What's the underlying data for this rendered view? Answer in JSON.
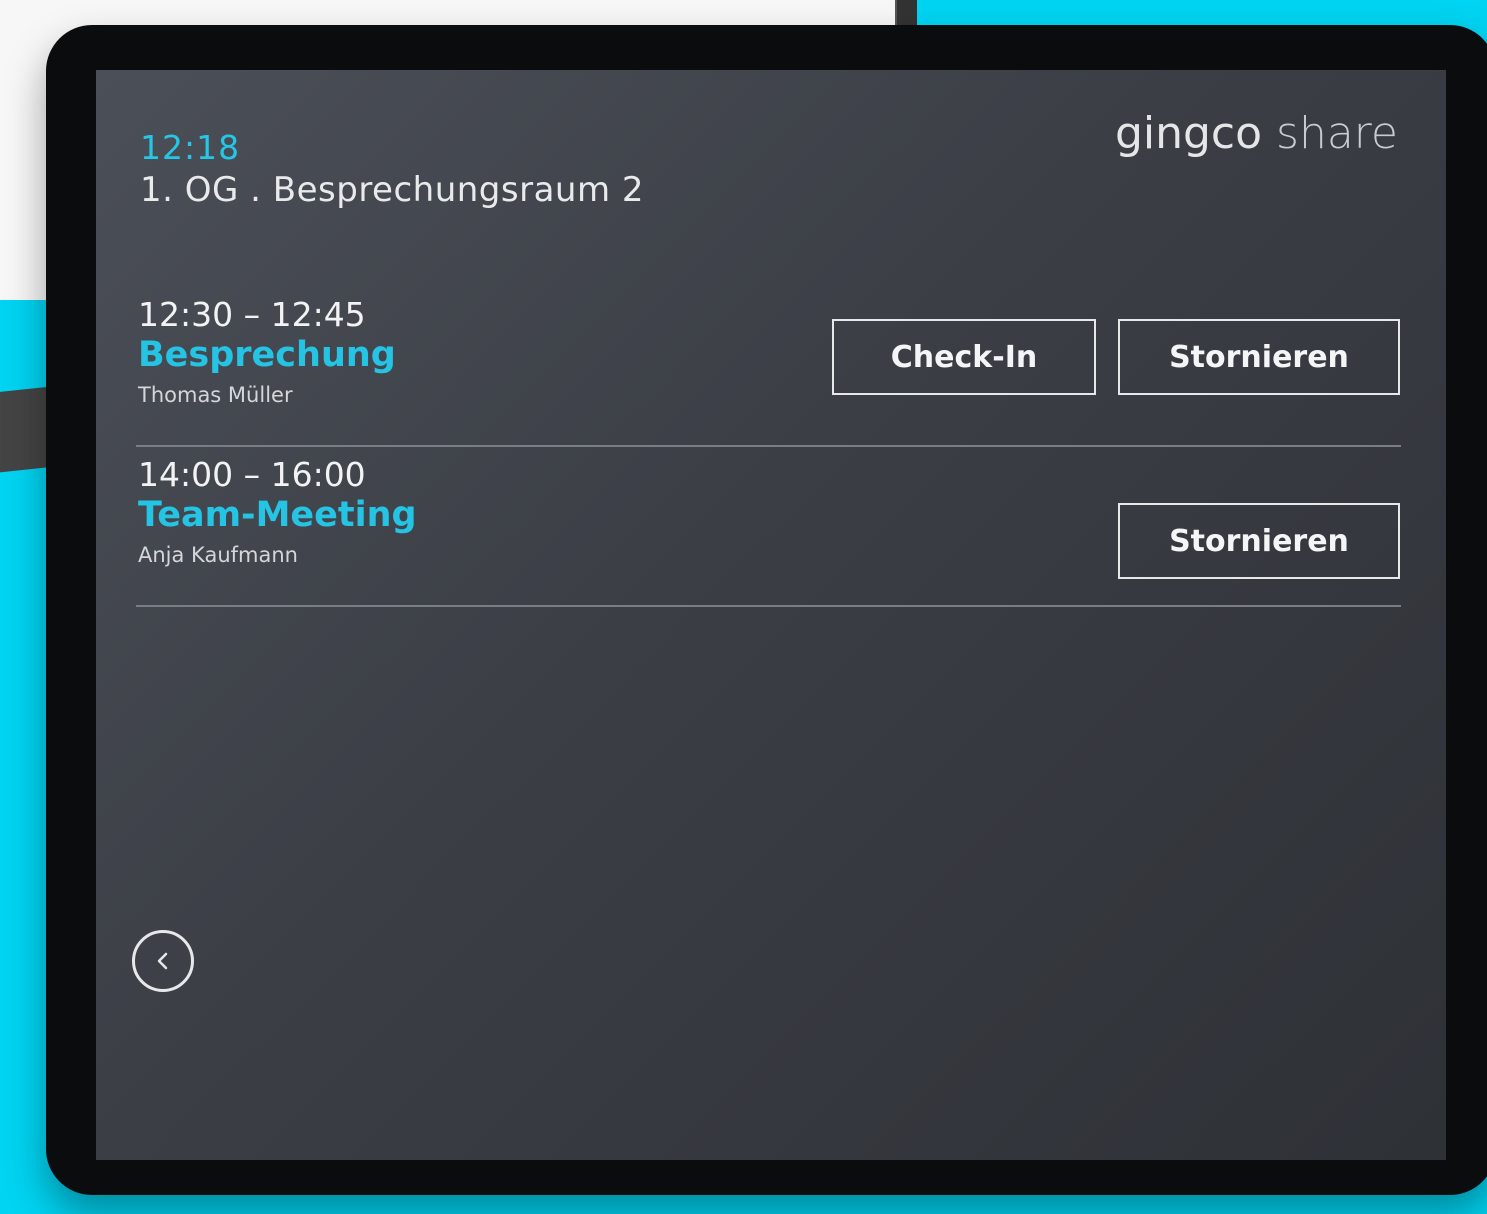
{
  "header": {
    "time": "12:18",
    "room": "1. OG . Besprechungsraum 2",
    "brand_bold": "gingco",
    "brand_light": "share"
  },
  "bookings": [
    {
      "time": "12:30 – 12:45",
      "title": "Besprechung",
      "organizer": "Thomas Müller",
      "checkin_label": "Check-In",
      "cancel_label": "Stornieren"
    },
    {
      "time": "14:00 – 16:00",
      "title": "Team-Meeting",
      "organizer": "Anja Kaufmann",
      "cancel_label": "Stornieren"
    }
  ],
  "navigation": {
    "back_icon": "chevron-left-circle-icon"
  },
  "colors": {
    "accent": "#26c6e6",
    "screen_bg": "#3e4148",
    "background": "#00d4f2"
  }
}
